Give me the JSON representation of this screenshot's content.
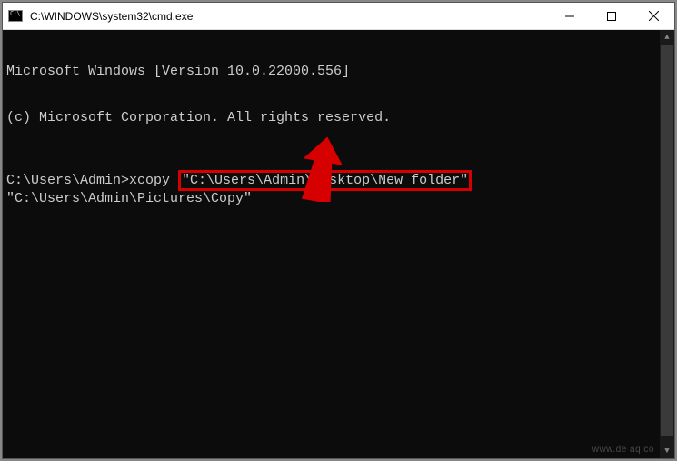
{
  "window": {
    "title": "C:\\WINDOWS\\system32\\cmd.exe"
  },
  "terminal": {
    "banner_line1": "Microsoft Windows [Version 10.0.22000.556]",
    "banner_line2": "(c) Microsoft Corporation. All rights reserved.",
    "prompt": "C:\\Users\\Admin>",
    "command": "xcopy ",
    "arg_source": "\"C:\\Users\\Admin\\Desktop\\New folder\"",
    "arg_dest": " \"C:\\Users\\Admin\\Pictures\\Copy\""
  },
  "watermark": "www.de aq co"
}
